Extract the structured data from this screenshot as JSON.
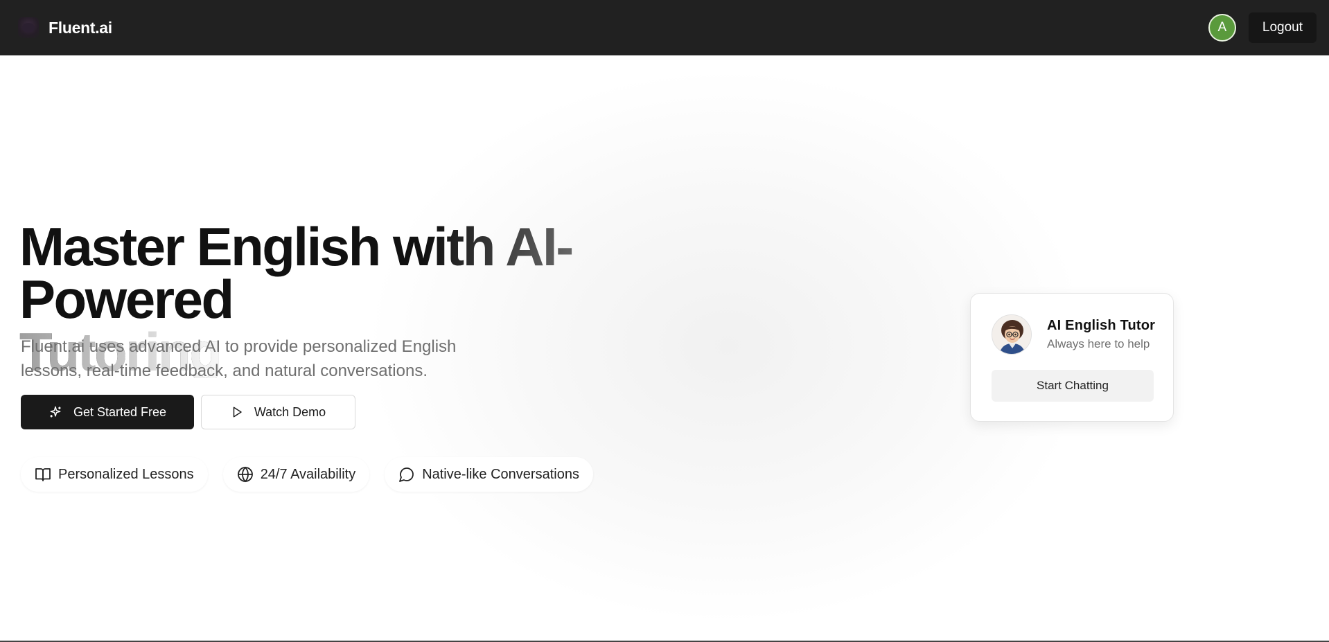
{
  "navbar": {
    "brand_name": "Fluent.ai",
    "logo_icon": "fluent-logo-icon",
    "avatar_initial": "A",
    "avatar_color": "#5a9a3c",
    "logout_label": "Logout"
  },
  "hero": {
    "headline_line1": "Master English with AI-Powered",
    "headline_line2": "Tutoring",
    "subtitle_line1": "Fluent.ai uses advanced AI to provide personalized English",
    "subtitle_line2": "lessons, real-time feedback, and natural conversations.",
    "primary_cta": {
      "label": "Get Started Free",
      "icon": "sparkles-icon"
    },
    "secondary_cta": {
      "label": "Watch Demo",
      "icon": "play-icon"
    },
    "features": [
      {
        "label": "Personalized Lessons",
        "icon": "book-open-icon"
      },
      {
        "label": "24/7 Availability",
        "icon": "globe-icon"
      },
      {
        "label": "Native-like Conversations",
        "icon": "message-circle-icon"
      }
    ]
  },
  "tutor_card": {
    "name": "AI English Tutor",
    "status": "Always here to help",
    "chat_button_label": "Start Chatting",
    "avatar_icon": "tutor-avatar-image"
  },
  "colors": {
    "navbar_bg": "#212121",
    "primary_button_bg": "#1a1a1a",
    "text_muted": "#6f6f6f"
  }
}
